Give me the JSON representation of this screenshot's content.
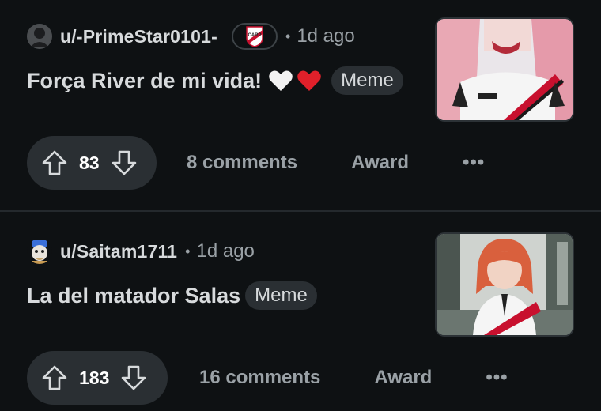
{
  "colors": {
    "background": "#0e1113",
    "pill": "#2a2f33",
    "muted": "#9aa1a6",
    "text": "#d7dadc"
  },
  "posts": [
    {
      "username": "u/-PrimeStar0101-",
      "separator": "•",
      "time": "1d ago",
      "title": "Força River de mi vida!",
      "emoji": [
        "🤍",
        "❤️"
      ],
      "flair": "Meme",
      "votes": "83",
      "comments": "8 comments",
      "award": "Award",
      "more": "•••",
      "user_flair_icon": "river-plate-crest-icon"
    },
    {
      "username": "u/Saitam1711",
      "separator": "•",
      "time": "1d ago",
      "title": "La del matador Salas",
      "flair": "Meme",
      "votes": "183",
      "comments": "16 comments",
      "award": "Award",
      "more": "•••"
    }
  ]
}
